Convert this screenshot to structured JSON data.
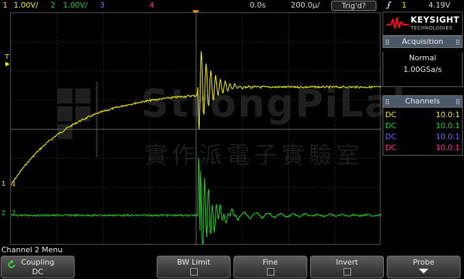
{
  "topbar": {
    "ch1_num": "1",
    "ch1_scale": "1.00V/",
    "ch2_num": "2",
    "ch2_scale": "1.00V/",
    "ch3_num": "3",
    "ch4_num": "4",
    "time_pos": "0.0s",
    "time_scale": "200.0µ/",
    "trigger_status": "Trig'd?",
    "trigger_slope_icon": "rising-edge-icon",
    "trigger_source": "1",
    "trigger_level": "4.19V"
  },
  "brand": {
    "name": "KEYSIGHT",
    "sub": "TECHNOLOGIES"
  },
  "acquisition": {
    "title": "Acquisition",
    "mode": "Normal",
    "rate": "1.00GSa/s"
  },
  "channels": {
    "title": "Channels",
    "rows": [
      {
        "coupling": "DC",
        "probe": "10.0:1",
        "color": "#f4f000"
      },
      {
        "coupling": "DC",
        "probe": "10.0:1",
        "color": "#22d020"
      },
      {
        "coupling": "DC",
        "probe": "10.0:1",
        "color": "#6f70ff"
      },
      {
        "coupling": "DC",
        "probe": "10.0:1",
        "color": "#ff2a9a"
      }
    ]
  },
  "screen": {
    "trigger_marker": "T",
    "ch1_marker": "1",
    "ch2_marker": "2"
  },
  "watermark": {
    "title": "StrongPiLab",
    "subtitle": "實作派電子實驗室"
  },
  "menu": {
    "title": "Channel 2 Menu",
    "softkeys": [
      {
        "label": "Coupling",
        "value": "DC"
      },
      {
        "label": "BW Limit"
      },
      {
        "label": "Fine"
      },
      {
        "label": "Invert"
      },
      {
        "label": "Probe"
      }
    ]
  }
}
